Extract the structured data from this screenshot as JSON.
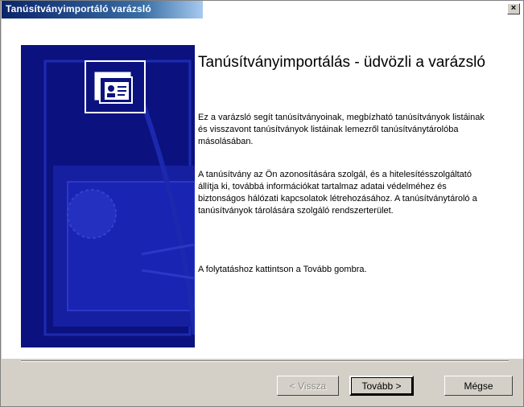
{
  "window": {
    "title": "Tanúsítványimportáló varázsló",
    "close_glyph": "×"
  },
  "main": {
    "heading": "Tanúsítványimportálás - üdvözli a varázsló",
    "paragraphs": [
      "Ez a varázsló segít tanúsítványoinak, megbízható tanúsítványok listáinak és visszavont tanúsítványok listáinak lemezről tanúsítványtárolóba másolásában.",
      "A tanúsítvány az Ön azonosítására szolgál, és a hitelesítésszolgáltató állítja ki, továbbá információkat tartalmaz adatai védelméhez és biztonságos hálózati kapcsolatok létrehozásához. A tanúsítványtároló a tanúsítványok tárolására szolgáló rendszerterület.",
      "A folytatáshoz kattintson a Tovább gombra."
    ]
  },
  "buttons": {
    "back": "< Vissza",
    "next": "Tovább >",
    "cancel": "Mégse"
  },
  "icons": {
    "close": "close-icon",
    "wizard": "certificate-card-icon"
  },
  "colors": {
    "title_gradient_start": "#0a246a",
    "art_background": "#0b1280"
  }
}
